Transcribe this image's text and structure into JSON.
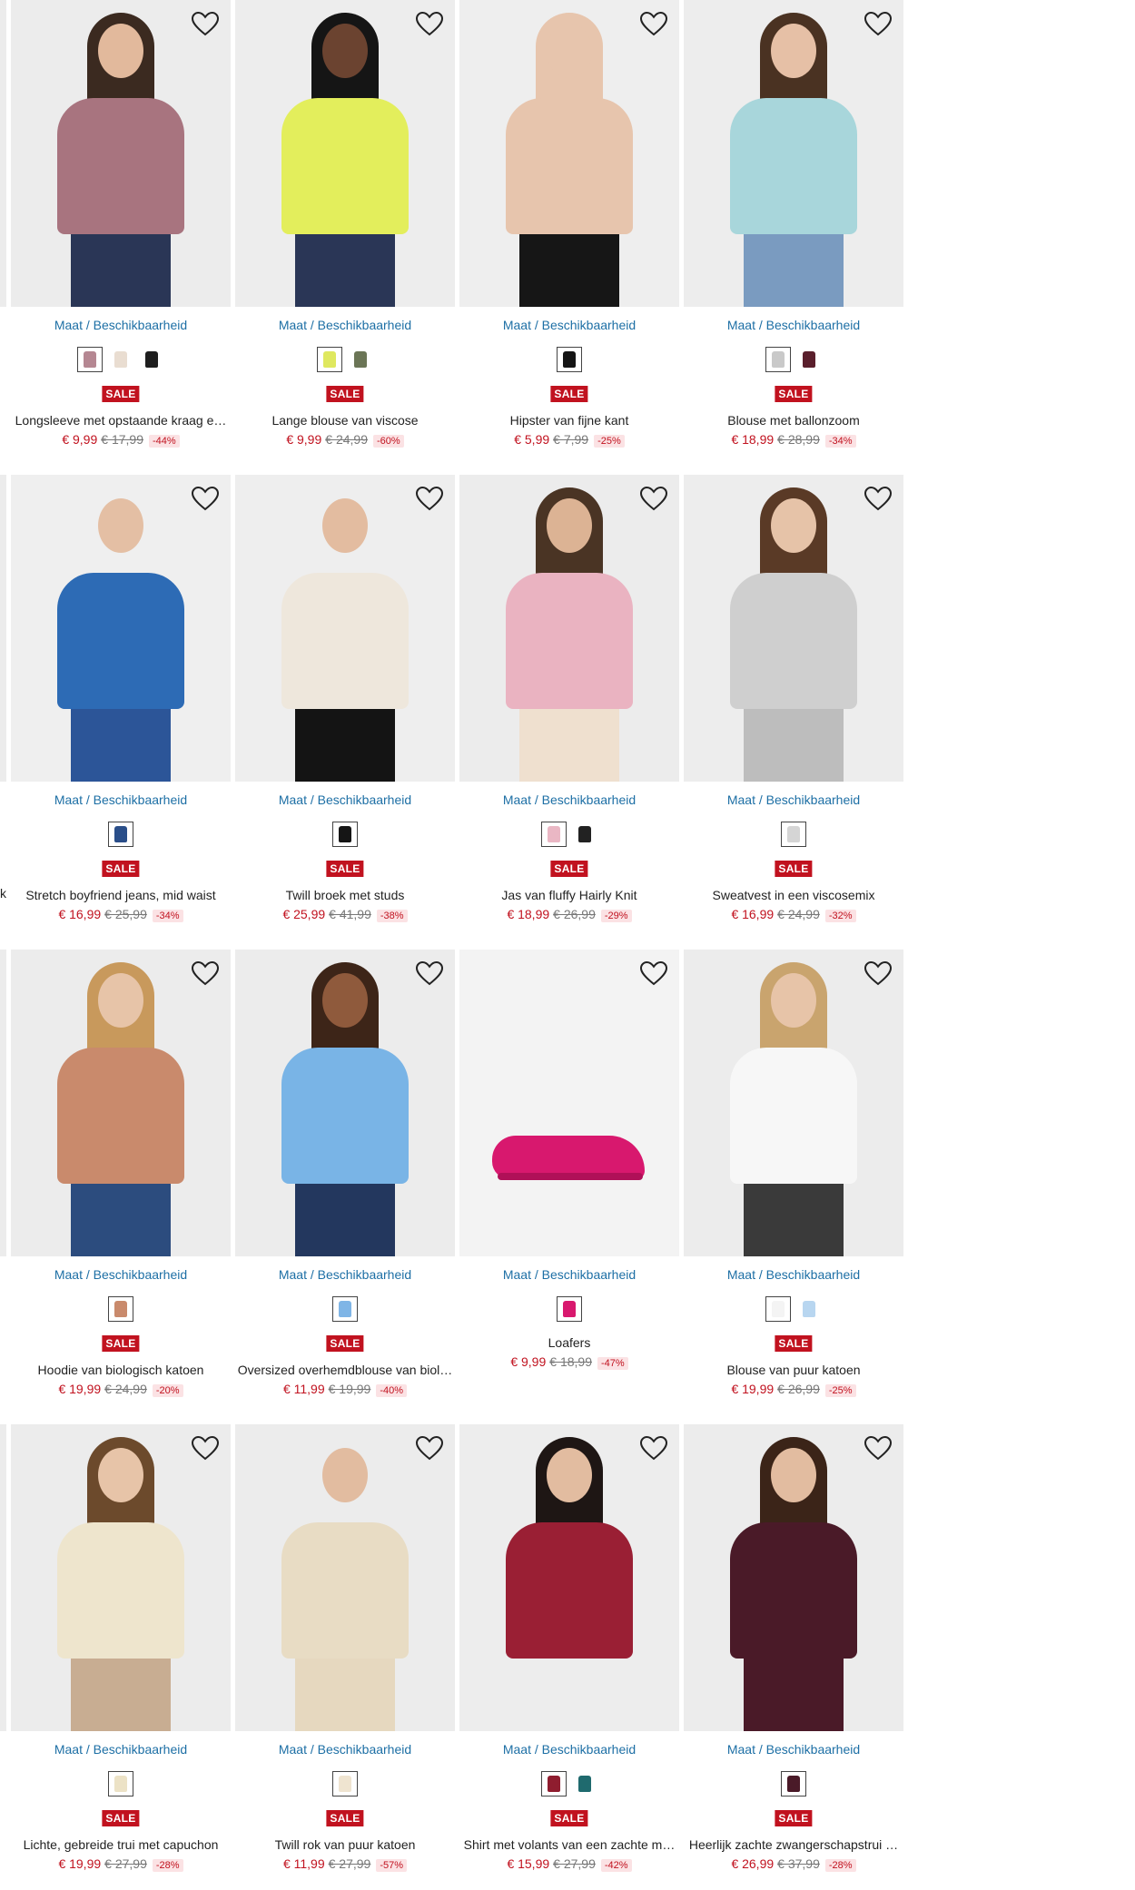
{
  "common": {
    "size_link": "Maat / Beschikbaarheid",
    "sale_badge": "SALE",
    "wishlist_icon": "heart-outline-icon"
  },
  "edge_fragment": "k",
  "products": [
    {
      "name": "Longsleeve met opstaande kraag e…",
      "price": "€ 9,99",
      "old_price": "€ 17,99",
      "discount": "-44%",
      "sale": true,
      "swatches": [
        "#b58792",
        "#e9ddd1",
        "#1e1e1e"
      ],
      "img": {
        "bg": "#ececec",
        "top": "#a8747f",
        "bottom": "#2a3656",
        "hair": "#3b2a20",
        "skin": "#e2b99c"
      }
    },
    {
      "name": "Lange blouse van viscose",
      "price": "€ 9,99",
      "old_price": "€ 24,99",
      "discount": "-60%",
      "sale": true,
      "swatches": [
        "#dfe85f",
        "#6b7556"
      ],
      "img": {
        "bg": "#ededed",
        "top": "#e3ee5c",
        "bottom": "#2a3656",
        "hair": "#151515",
        "skin": "#6b4330"
      }
    },
    {
      "name": "Hipster van fijne kant",
      "price": "€ 5,99",
      "old_price": "€ 7,99",
      "discount": "-25%",
      "sale": true,
      "swatches": [
        "#151515"
      ],
      "img": {
        "bg": "#eeeeee",
        "top": "#e7c5ad",
        "bottom": "#161616",
        "hair": "#e7c5ad",
        "skin": "#e7c5ad"
      }
    },
    {
      "name": "Blouse met ballonzoom",
      "price": "€ 18,99",
      "old_price": "€ 28,99",
      "discount": "-34%",
      "sale": true,
      "swatches": [
        "#c9c9c9",
        "#5a1f2c"
      ],
      "img": {
        "bg": "#ededed",
        "top": "#a8d6db",
        "bottom": "#7a9bc0",
        "hair": "#4a3222",
        "skin": "#e6c0a6"
      }
    },
    {
      "name": "Stretch boyfriend jeans, mid waist",
      "price": "€ 16,99",
      "old_price": "€ 25,99",
      "discount": "-34%",
      "sale": true,
      "swatches": [
        "#2a4e89"
      ],
      "img": {
        "bg": "#efefef",
        "top": "#2d6bb5",
        "bottom": "#2c5598",
        "hair": "#efefef",
        "skin": "#e4bfa4"
      }
    },
    {
      "name": "Twill broek met studs",
      "price": "€ 25,99",
      "old_price": "€ 41,99",
      "discount": "-38%",
      "sale": true,
      "swatches": [
        "#151515"
      ],
      "img": {
        "bg": "#eeeeee",
        "top": "#eee7dc",
        "bottom": "#141414",
        "hair": "#eeeeee",
        "skin": "#e3bca0"
      }
    },
    {
      "name": "Jas van fluffy Hairly Knit",
      "price": "€ 18,99",
      "old_price": "€ 26,99",
      "discount": "-29%",
      "sale": true,
      "swatches": [
        "#eab7c4",
        "#222222"
      ],
      "img": {
        "bg": "#ececec",
        "top": "#eab3c1",
        "bottom": "#efe0cf",
        "hair": "#4a3424",
        "skin": "#dcb394"
      }
    },
    {
      "name": "Sweatvest in een viscosemix",
      "price": "€ 16,99",
      "old_price": "€ 24,99",
      "discount": "-32%",
      "sale": true,
      "swatches": [
        "#d5d5d5"
      ],
      "img": {
        "bg": "#ededed",
        "top": "#cfcfcf",
        "bottom": "#bdbdbd",
        "hair": "#5a3a26",
        "skin": "#e6c3a8"
      }
    },
    {
      "name": "Hoodie van biologisch katoen",
      "price": "€ 19,99",
      "old_price": "€ 24,99",
      "discount": "-20%",
      "sale": true,
      "swatches": [
        "#c98a6c"
      ],
      "img": {
        "bg": "#ececec",
        "top": "#c98a6c",
        "bottom": "#2c4c7e",
        "hair": "#c8995c",
        "skin": "#e7c4a8"
      }
    },
    {
      "name": "Oversized overhemdblouse van biol…",
      "price": "€ 11,99",
      "old_price": "€ 19,99",
      "discount": "-40%",
      "sale": true,
      "swatches": [
        "#7fb5e6"
      ],
      "img": {
        "bg": "#ececec",
        "top": "#79b4e6",
        "bottom": "#23375e",
        "hair": "#3d2518",
        "skin": "#8f5a3c"
      }
    },
    {
      "name": "Loafers",
      "price": "€ 9,99",
      "old_price": "€ 18,99",
      "discount": "-47%",
      "sale": false,
      "swatches": [
        "#d8186e"
      ],
      "img": {
        "bg": "#f3f3f3",
        "top": "#d8186e",
        "bottom": "#f3f3f3",
        "hair": "#f3f3f3",
        "skin": "#f3f3f3"
      }
    },
    {
      "name": "Blouse van puur katoen",
      "price": "€ 19,99",
      "old_price": "€ 26,99",
      "discount": "-25%",
      "sale": true,
      "swatches": [
        "#f4f4f4",
        "#b8d6f0"
      ],
      "img": {
        "bg": "#ececec",
        "top": "#f7f7f7",
        "bottom": "#3a3a3a",
        "hair": "#c9a46e",
        "skin": "#e7c4a8"
      }
    },
    {
      "name": "Lichte, gebreide trui met capuchon",
      "price": "€ 19,99",
      "old_price": "€ 27,99",
      "discount": "-28%",
      "sale": true,
      "swatches": [
        "#ece2c6"
      ],
      "img": {
        "bg": "#ececec",
        "top": "#eee5cd",
        "bottom": "#c8ad92",
        "hair": "#6c4a2c",
        "skin": "#e7c4a8"
      }
    },
    {
      "name": "Twill rok van puur katoen",
      "price": "€ 11,99",
      "old_price": "€ 27,99",
      "discount": "-57%",
      "sale": true,
      "swatches": [
        "#efe4d0"
      ],
      "img": {
        "bg": "#ececec",
        "top": "#e8dcc4",
        "bottom": "#e6d8bf",
        "hair": "#ececec",
        "skin": "#e2bca0"
      }
    },
    {
      "name": "Shirt met volants van een zachte m…",
      "price": "€ 15,99",
      "old_price": "€ 27,99",
      "discount": "-42%",
      "sale": true,
      "swatches": [
        "#8f1d2f",
        "#1f6a6e"
      ],
      "img": {
        "bg": "#ededed",
        "top": "#9a1f34",
        "bottom": "#ededed",
        "hair": "#1e1614",
        "skin": "#e2bca0"
      }
    },
    {
      "name": "Heerlijk zachte zwangerschapstrui …",
      "price": "€ 26,99",
      "old_price": "€ 37,99",
      "discount": "-28%",
      "sale": true,
      "swatches": [
        "#4a1a28"
      ],
      "img": {
        "bg": "#ececec",
        "top": "#4a1a28",
        "bottom": "#4a1a28",
        "hair": "#3b2418",
        "skin": "#e2bca0"
      }
    }
  ]
}
